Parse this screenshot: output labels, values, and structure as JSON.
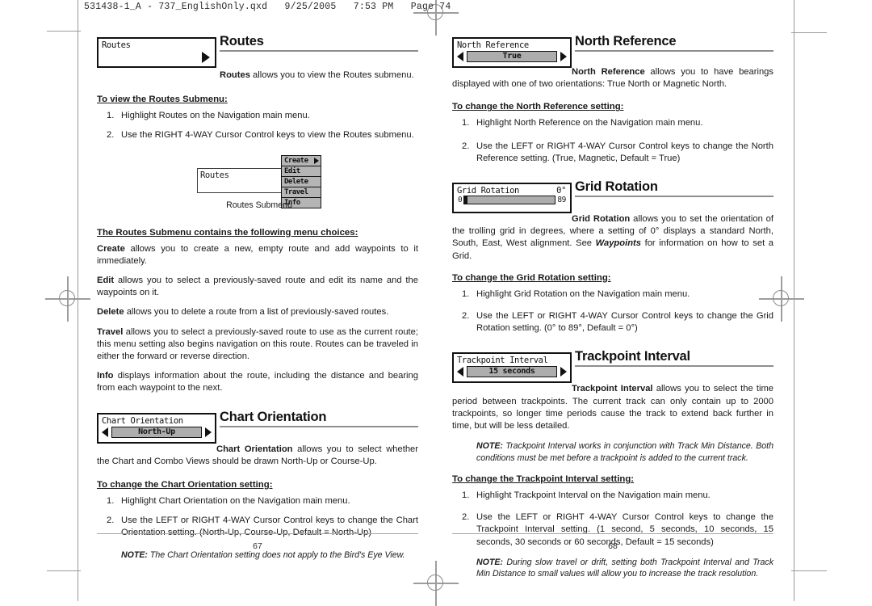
{
  "file_header": "531438-1_A - 737_EnglishOnly.qxd   9/25/2005   7:53 PM   Page 74",
  "left_page": {
    "routes": {
      "widget_label": "Routes",
      "title": "Routes",
      "intro_bold": "Routes",
      "intro_rest": " allows you to view the Routes submenu.",
      "howto_head": "To view the Routes Submenu:",
      "steps": [
        {
          "num": "1.",
          "text": "Highlight Routes on the Navigation main menu."
        },
        {
          "num": "2.",
          "text": "Use the RIGHT 4-WAY Cursor Control keys to view the Routes submenu."
        }
      ],
      "submenu": {
        "parent_label": "Routes",
        "items": [
          "Create",
          "Edit",
          "Delete",
          "Travel",
          "Info"
        ],
        "caption": "Routes Submenu"
      },
      "choices_head": "The Routes Submenu contains the following menu choices:",
      "choices": [
        {
          "term": "Create",
          "desc": " allows you to create a new, empty route and add waypoints to it immediately."
        },
        {
          "term": "Edit",
          "desc": " allows you to select a previously-saved route and edit its name and the waypoints on it."
        },
        {
          "term": "Delete",
          "desc": " allows you to delete a route from a list of previously-saved routes."
        },
        {
          "term": "Travel",
          "desc": " allows you to select a previously-saved route to use as the current route; this menu setting also begins navigation on this route. Routes can be traveled in either the forward or reverse direction."
        },
        {
          "term": "Info",
          "desc": " displays information about the route, including the distance and bearing from each waypoint to the next."
        }
      ]
    },
    "chart_orientation": {
      "widget_label": "Chart Orientation",
      "widget_value": "North-Up",
      "title": "Chart Orientation",
      "intro_bold": "Chart Orientation",
      "intro_rest": " allows you to select whether the Chart and Combo Views should be drawn North-Up or Course-Up.",
      "howto_head": "To change the Chart Orientation setting:",
      "steps": [
        {
          "num": "1.",
          "text": "Highlight Chart Orientation on the Navigation main menu."
        },
        {
          "num": "2.",
          "text": "Use the LEFT or RIGHT 4-WAY Cursor Control keys to change the Chart Orientation setting. (North-Up, Course-Up, Default = North-Up)"
        }
      ],
      "note_label": "NOTE:",
      "note_text": " The Chart Orientation setting does not apply to the Bird's Eye View."
    },
    "page_number": "67"
  },
  "right_page": {
    "north_reference": {
      "widget_label": "North Reference",
      "widget_value": "True",
      "title": "North Reference",
      "intro_bold": "North Reference",
      "intro_rest": " allows you to have bearings displayed with one of two orientations: True North or Magnetic North.",
      "howto_head": "To change the North Reference setting:",
      "steps": [
        {
          "num": "1.",
          "text": "Highlight North Reference on the Navigation main menu."
        },
        {
          "num": "2.",
          "text": "Use the LEFT or RIGHT 4-WAY Cursor Control keys to change the North Reference setting. (True, Magnetic, Default = True)"
        }
      ]
    },
    "grid_rotation": {
      "widget_label": "Grid Rotation",
      "widget_value": "0°",
      "slider_min": "0",
      "slider_max": "89",
      "title": "Grid Rotation",
      "intro_bold": "Grid Rotation",
      "intro_rest": " allows you to set the orientation of the trolling grid in degrees, where a setting of 0° displays a standard North, South, East, West alignment. See ",
      "intro_italic": "Waypoints",
      "intro_tail": " for information on how to set a Grid.",
      "howto_head": "To change the Grid Rotation setting:",
      "steps": [
        {
          "num": "1.",
          "text": "Highlight Grid Rotation on the Navigation main menu."
        },
        {
          "num": "2.",
          "text": "Use the LEFT or RIGHT 4-WAY Cursor Control keys to change the Grid Rotation setting. (0° to 89°, Default = 0°)"
        }
      ]
    },
    "trackpoint_interval": {
      "widget_label": "Trackpoint Interval",
      "widget_value": "15 seconds",
      "title": "Trackpoint Interval",
      "intro_bold": "Trackpoint Interval",
      "intro_rest": " allows you to select the time period between trackpoints. The current track can only contain up to 2000 trackpoints, so longer time periods cause the track to extend back further in time, but will be less detailed.",
      "note1_label": "NOTE:",
      "note1_text": " Trackpoint Interval works in conjunction with Track Min Distance.  Both conditions must be met before a trackpoint is added to the current track.",
      "howto_head": "To change the Trackpoint Interval setting:",
      "steps": [
        {
          "num": "1.",
          "text": "Highlight Trackpoint Interval on the Navigation main menu."
        },
        {
          "num": "2.",
          "text": "Use the LEFT or RIGHT 4-WAY Cursor Control keys to change the Trackpoint Interval setting. (1 second, 5 seconds, 10 seconds, 15 seconds, 30 seconds or 60 seconds, Default = 15 seconds)"
        }
      ],
      "note2_label": "NOTE:",
      "note2_text": " During slow travel or drift, setting both Trackpoint Interval and Track Min Distance to small values will allow you to increase the track resolution."
    },
    "page_number": "68"
  }
}
